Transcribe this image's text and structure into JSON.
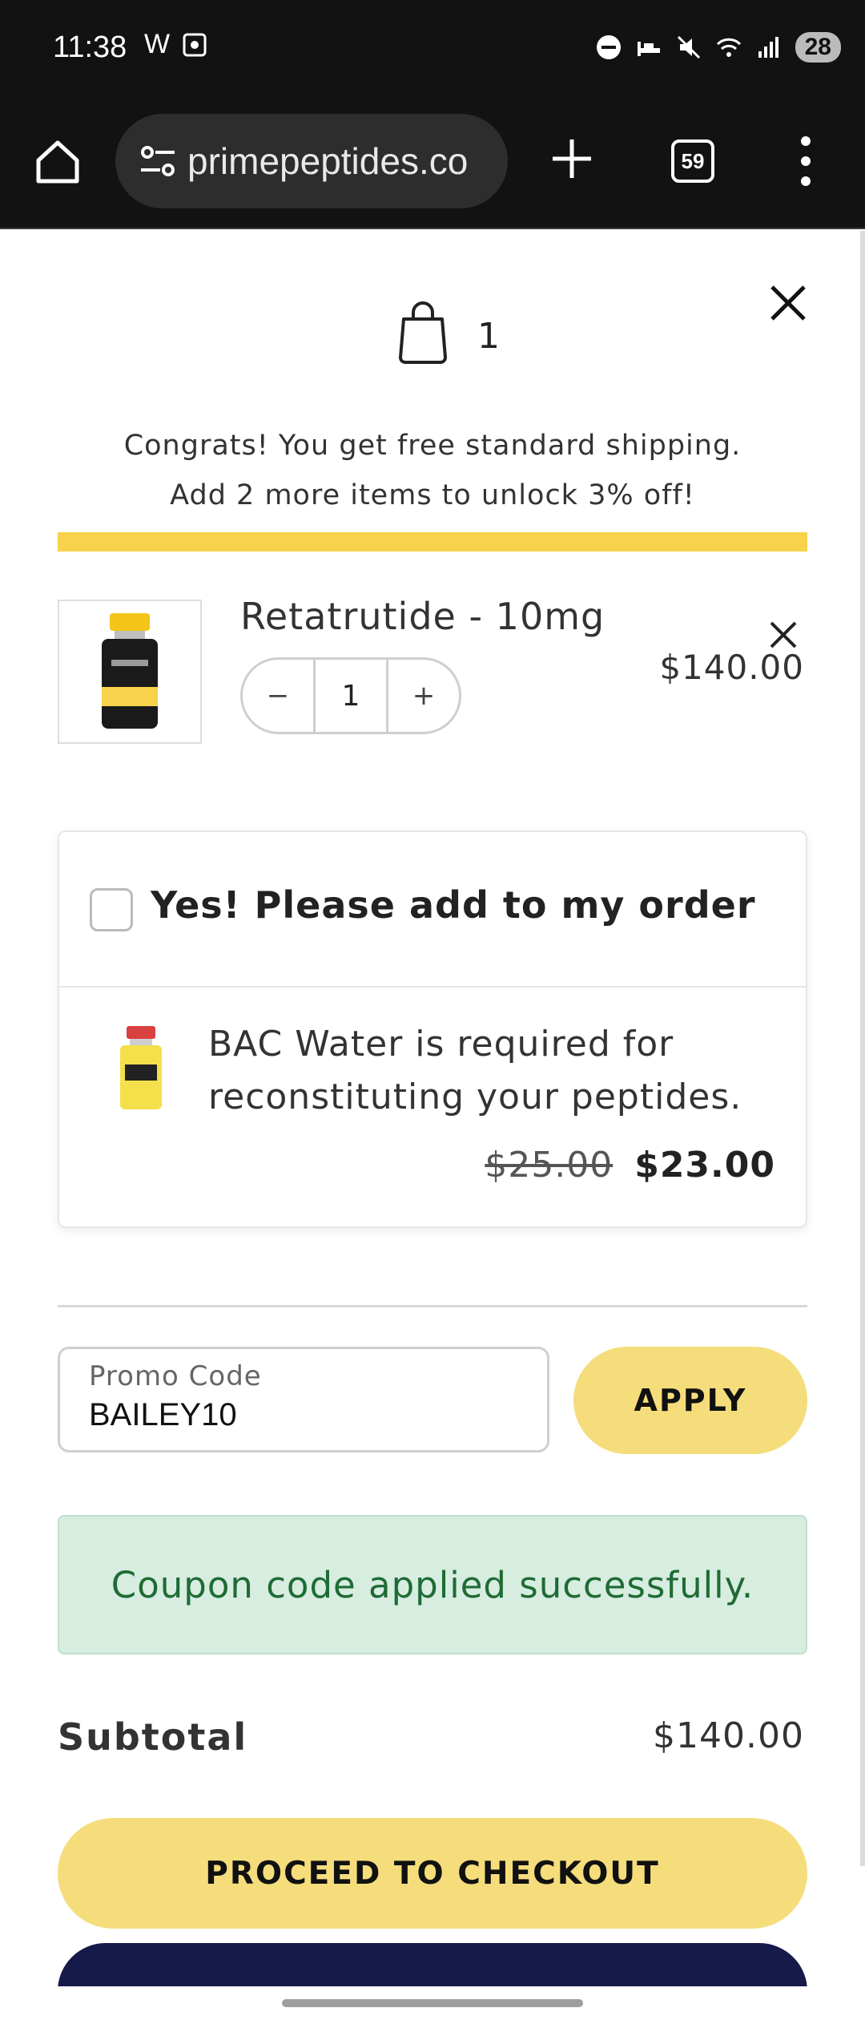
{
  "status_bar": {
    "time": "11:38",
    "left_icons": [
      "w-icon",
      "screenshot-icon"
    ],
    "right_icons": [
      "dnd-icon",
      "sleep-icon",
      "mute-icon",
      "wifi-icon",
      "signal-icon"
    ],
    "battery": "28"
  },
  "browser": {
    "url": "primepeptides.co",
    "tab_count": "59"
  },
  "cart": {
    "item_count": "1",
    "shipping_message": "Congrats! You get free standard shipping.",
    "upsell_message": "Add 2 more items to unlock 3% off!",
    "progress_color": "#f7d24a",
    "items": [
      {
        "name": "Retatrutide - 10mg",
        "quantity": "1",
        "price": "$140.00",
        "minus_label": "−",
        "plus_label": "+"
      }
    ]
  },
  "upsell_offer": {
    "checkbox_label": "Yes! Please add to my order",
    "description": "BAC Water is required for reconstituting your peptides.",
    "old_price": "$25.00",
    "new_price": "$23.00"
  },
  "promo": {
    "label": "Promo Code",
    "value": "BAILEY10",
    "apply_label": "APPLY",
    "success_message": "Coupon code applied successfully."
  },
  "totals": {
    "subtotal_label": "Subtotal",
    "subtotal_value": "$140.00"
  },
  "actions": {
    "checkout_label": "PROCEED TO CHECKOUT"
  },
  "colors": {
    "accent_yellow": "#f5dd7c",
    "success_bg": "#d7ede0",
    "success_text": "#1f6b35",
    "navy": "#151a4a"
  }
}
